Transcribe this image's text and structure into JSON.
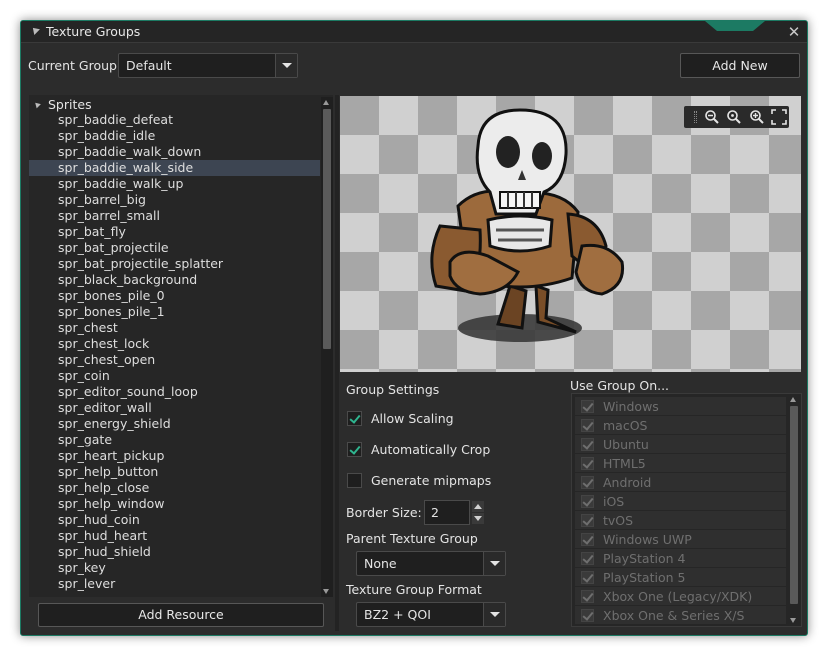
{
  "window": {
    "title": "Texture Groups",
    "close_glyph": "✕"
  },
  "header": {
    "current_group_label": "Current Group:",
    "current_group_value": "Default",
    "add_new_label": "Add New"
  },
  "tree": {
    "root_label": "Sprites",
    "selected_index": 3,
    "items": [
      "spr_baddie_defeat",
      "spr_baddie_idle",
      "spr_baddie_walk_down",
      "spr_baddie_walk_side",
      "spr_baddie_walk_up",
      "spr_barrel_big",
      "spr_barrel_small",
      "spr_bat_fly",
      "spr_bat_projectile",
      "spr_bat_projectile_splatter",
      "spr_black_background",
      "spr_bones_pile_0",
      "spr_bones_pile_1",
      "spr_chest",
      "spr_chest_lock",
      "spr_chest_open",
      "spr_coin",
      "spr_editor_sound_loop",
      "spr_editor_wall",
      "spr_energy_shield",
      "spr_gate",
      "spr_heart_pickup",
      "spr_help_button",
      "spr_help_close",
      "spr_help_window",
      "spr_hud_coin",
      "spr_hud_heart",
      "spr_hud_shield",
      "spr_key",
      "spr_lever"
    ],
    "add_resource_label": "Add Resource"
  },
  "preview": {
    "zoom_icons": [
      "zoom-out-icon",
      "zoom-reset-icon",
      "zoom-in-icon",
      "fullscreen-icon"
    ],
    "checker_light": "#d0d0d0",
    "checker_dark": "#a7a7a7"
  },
  "settings": {
    "title": "Group Settings",
    "allow_scaling": {
      "label": "Allow Scaling",
      "checked": true
    },
    "auto_crop": {
      "label": "Automatically Crop",
      "checked": true
    },
    "mipmaps": {
      "label": "Generate mipmaps",
      "checked": false
    },
    "border_size_label": "Border Size:",
    "border_size_value": "2",
    "parent_label": "Parent Texture Group",
    "parent_value": "None",
    "format_label": "Texture Group Format",
    "format_value": "BZ2 + QOI"
  },
  "use_group_on": {
    "title": "Use Group On...",
    "platforms": [
      "Windows",
      "macOS",
      "Ubuntu",
      "HTML5",
      "Android",
      "iOS",
      "tvOS",
      "Windows UWP",
      "PlayStation 4",
      "PlayStation 5",
      "Xbox One (Legacy/XDK)",
      "Xbox One & Series X/S"
    ]
  },
  "colors": {
    "accent": "#1c7a63",
    "check": "#2fb58f",
    "selected_row": "#3d4552"
  }
}
